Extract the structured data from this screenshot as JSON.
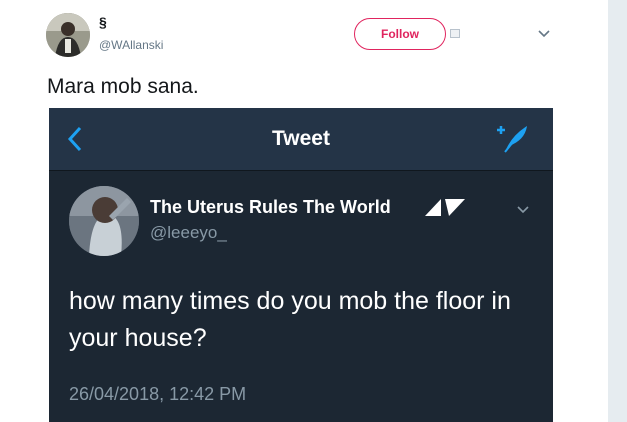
{
  "tweet": {
    "author": {
      "display_name": "§",
      "handle": "@WAllanski",
      "avatar": "profile-photo"
    },
    "follow_label": "Follow",
    "text": "Mara mob sana.",
    "icons": {
      "menu": "chevron-down-icon",
      "extra": "small-badge-icon"
    },
    "accent_color": "#e0245e"
  },
  "embedded_screenshot": {
    "header_title": "Tweet",
    "header_icons": [
      "back-chevron-icon",
      "compose-feather-icon"
    ],
    "theme": {
      "background": "#1c2733",
      "header": "#243447",
      "accent": "#1da1f2"
    },
    "author": {
      "display_name": "The Uterus Rules The World",
      "handle": "@leeeyo_",
      "name_logo": "triangle-logo-icon"
    },
    "body": "how many times do you mob the floor in your house?",
    "timestamp": "26/04/2018, 12:42 PM"
  }
}
